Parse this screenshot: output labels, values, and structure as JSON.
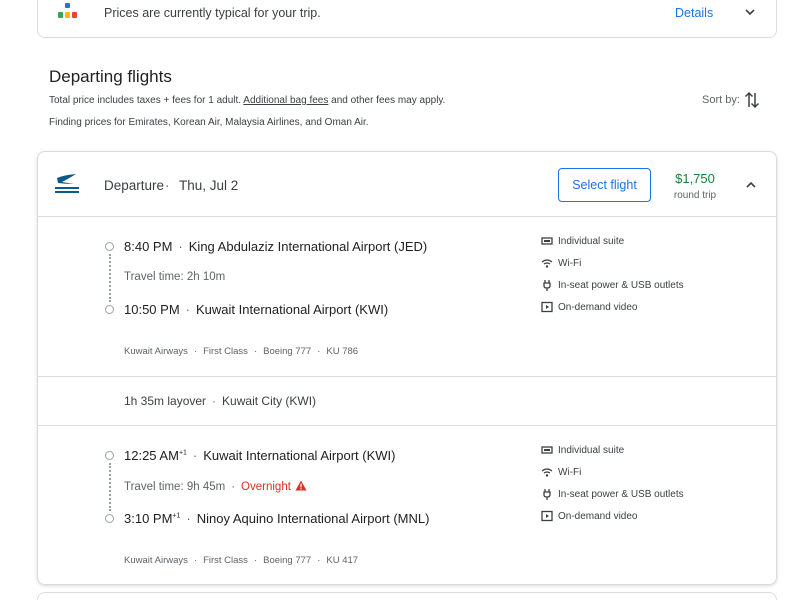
{
  "insight": {
    "text": "Prices are currently typical for your trip.",
    "details_label": "Details"
  },
  "section": {
    "title": "Departing flights",
    "subtitle_prefix": "Total price includes taxes + fees for 1 adult. ",
    "subtitle_link": "Additional bag fees",
    "subtitle_suffix": " and other fees may apply.",
    "finding_text": "Finding prices for Emirates, Korean Air, Malaysia Airlines, and Oman Air.",
    "sort_label": "Sort by:"
  },
  "card": {
    "departure_label": "Departure",
    "separator": "·",
    "date": "Thu, Jul 2",
    "select_label": "Select flight",
    "price": "$1,750",
    "price_sub": "round trip",
    "legs": [
      {
        "dep_time": "8:40 PM",
        "dep_sup": "",
        "dep_airport": "King Abdulaziz International Airport (JED)",
        "travel_time": "Travel time: 2h 10m",
        "overnight": "",
        "arr_time": "10:50 PM",
        "arr_sup": "",
        "arr_airport": "Kuwait International Airport (KWI)",
        "airline": "Kuwait Airways",
        "cabin": "First Class",
        "aircraft": "Boeing 777",
        "flight_no": "KU 786",
        "amenities": [
          "Individual suite",
          "Wi-Fi",
          "In-seat power & USB outlets",
          "On-demand video"
        ]
      },
      {
        "dep_time": "12:25 AM",
        "dep_sup": "+1",
        "dep_airport": "Kuwait International Airport (KWI)",
        "travel_time": "Travel time: 9h 45m",
        "overnight": "Overnight",
        "arr_time": "3:10 PM",
        "arr_sup": "+1",
        "arr_airport": "Ninoy Aquino International Airport (MNL)",
        "airline": "Kuwait Airways",
        "cabin": "First Class",
        "aircraft": "Boeing 777",
        "flight_no": "KU 417",
        "amenities": [
          "Individual suite",
          "Wi-Fi",
          "In-seat power & USB outlets",
          "On-demand video"
        ]
      }
    ],
    "layover": {
      "duration": "1h 35m layover",
      "city": "Kuwait City (KWI)"
    }
  },
  "colors": {
    "accent": "#1a73e8",
    "price_green": "#188038",
    "warning_red": "#d93025",
    "border": "#dadce0"
  },
  "icons": [
    "price-insight-icon",
    "chevron-down-icon",
    "sort-icon",
    "airline-logo",
    "chevron-up-icon",
    "seat-icon",
    "wifi-icon",
    "power-plug-icon",
    "video-icon",
    "warning-icon"
  ]
}
